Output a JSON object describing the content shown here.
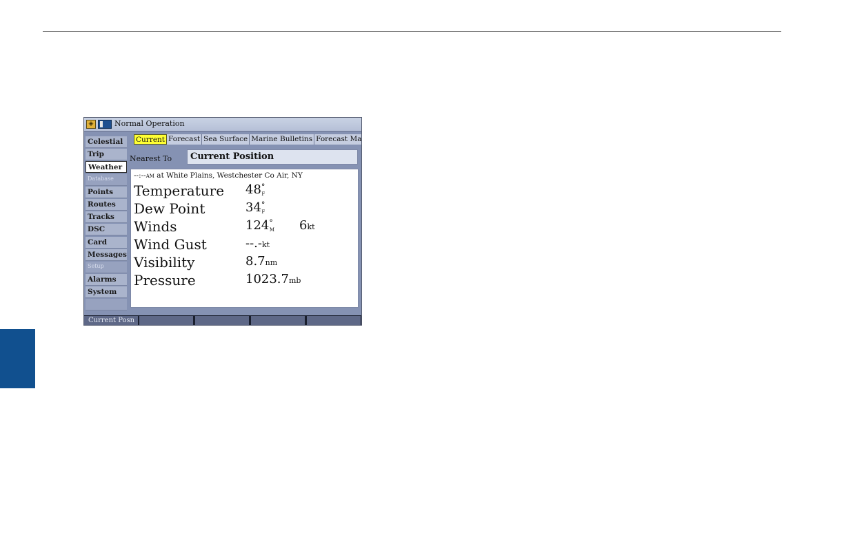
{
  "window": {
    "title": "Normal Operation"
  },
  "sidebar": {
    "items": [
      {
        "label": "Celestial",
        "state": "normal"
      },
      {
        "label": "Trip",
        "state": "normal"
      },
      {
        "label": "Weather",
        "state": "selected"
      },
      {
        "label": "Database",
        "state": "disabled"
      },
      {
        "label": "Points",
        "state": "normal"
      },
      {
        "label": "Routes",
        "state": "normal"
      },
      {
        "label": "Tracks",
        "state": "normal"
      },
      {
        "label": "DSC",
        "state": "normal"
      },
      {
        "label": "Card",
        "state": "normal"
      },
      {
        "label": "Messages",
        "state": "normal"
      },
      {
        "label": "Setup",
        "state": "disabled"
      },
      {
        "label": "Alarms",
        "state": "normal"
      },
      {
        "label": "System",
        "state": "normal"
      }
    ]
  },
  "tabs": [
    "Current",
    "Forecast",
    "Sea Surface",
    "Marine Bulletins",
    "Forecast Map"
  ],
  "active_tab": "Current",
  "nearest": {
    "label": "Nearest To",
    "value": "Current Position"
  },
  "observation": {
    "time": "--:--",
    "ampm": "AM",
    "location": " at White Plains, Westchester Co Air, NY"
  },
  "readings": {
    "temperature": {
      "label": "Temperature",
      "value": "48",
      "unit": "F"
    },
    "dew_point": {
      "label": "Dew Point",
      "value": "34",
      "unit": "F"
    },
    "winds": {
      "label": "Winds",
      "value": "124",
      "unit": "M",
      "speed": "6",
      "speed_unit": "kt"
    },
    "wind_gust": {
      "label": "Wind Gust",
      "value": "--.-",
      "unit": "kt"
    },
    "visibility": {
      "label": "Visibility",
      "value": "8.7",
      "unit": "nm"
    },
    "pressure": {
      "label": "Pressure",
      "value": "1023.7",
      "unit": "mb"
    }
  },
  "softkeys": [
    "Current Posn",
    "",
    "",
    "",
    ""
  ],
  "colors": {
    "accent_tab": "#ffff33",
    "side_tab": "#11508f",
    "device_frame": "#8592b3"
  }
}
